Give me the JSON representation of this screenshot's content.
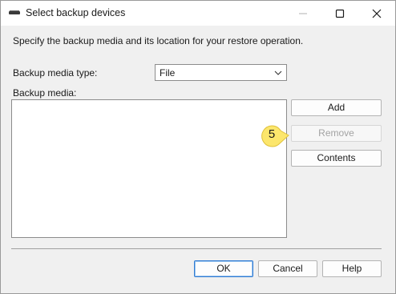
{
  "window": {
    "title": "Select backup devices",
    "controls": {
      "minimize_icon": "minimize-icon",
      "maximize_icon": "maximize-icon",
      "close_icon": "close-icon"
    }
  },
  "dialog": {
    "description": "Specify the backup media and its location for your restore operation.",
    "media_type": {
      "label": "Backup media type:",
      "selected": "File"
    },
    "media_list_label": "Backup media:",
    "side_buttons": {
      "add": "Add",
      "remove": "Remove",
      "contents": "Contents"
    },
    "footer_buttons": {
      "ok": "OK",
      "cancel": "Cancel",
      "help": "Help"
    }
  },
  "annotation": {
    "step_number": "5"
  },
  "colors": {
    "callout_fill": "#fce66c",
    "default_button_border": "#2f7bd3"
  }
}
